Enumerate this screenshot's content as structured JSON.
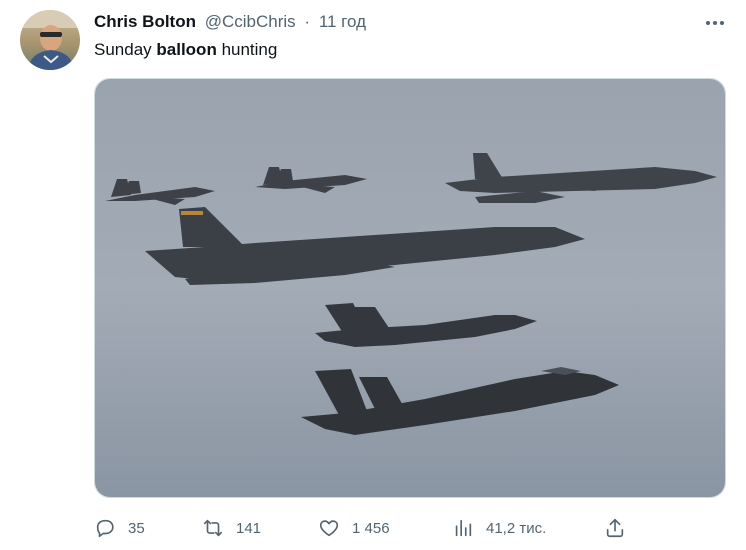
{
  "tweet": {
    "author_name": "Chris Bolton",
    "author_handle": "@CcibChris",
    "separator": "·",
    "time": "11 год",
    "text_before": "Sunday ",
    "text_bold": "balloon",
    "text_after": " hunting"
  },
  "icons": {
    "more": "more-dots-icon",
    "reply": "reply-icon",
    "retweet": "retweet-icon",
    "like": "heart-icon",
    "views": "analytics-icon",
    "share": "share-icon"
  },
  "actions": {
    "replies": "35",
    "retweets": "141",
    "likes": "1 456",
    "views": "41,2 тис."
  },
  "colors": {
    "text": "#0f1419",
    "secondary": "#536471",
    "border": "#cfd9de"
  }
}
